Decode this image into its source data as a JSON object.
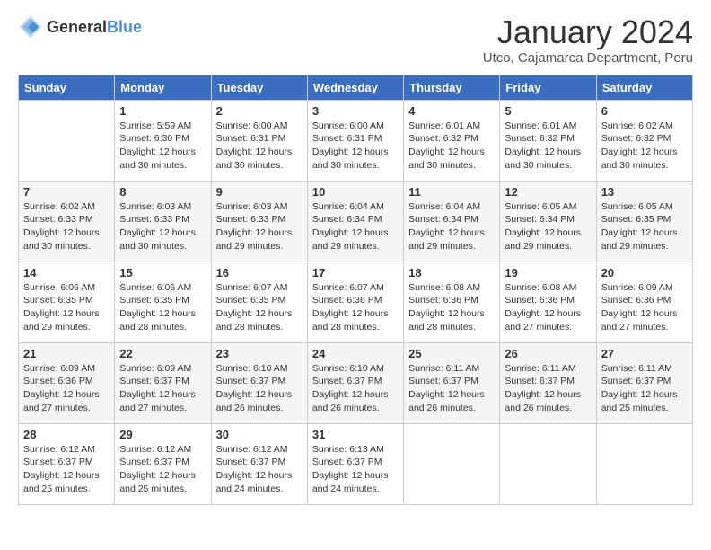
{
  "logo": {
    "text_general": "General",
    "text_blue": "Blue"
  },
  "header": {
    "month_year": "January 2024",
    "location": "Utco, Cajamarca Department, Peru"
  },
  "days_of_week": [
    "Sunday",
    "Monday",
    "Tuesday",
    "Wednesday",
    "Thursday",
    "Friday",
    "Saturday"
  ],
  "weeks": [
    [
      {
        "day": "",
        "sunrise": "",
        "sunset": "",
        "daylight": ""
      },
      {
        "day": "1",
        "sunrise": "Sunrise: 5:59 AM",
        "sunset": "Sunset: 6:30 PM",
        "daylight": "Daylight: 12 hours and 30 minutes."
      },
      {
        "day": "2",
        "sunrise": "Sunrise: 6:00 AM",
        "sunset": "Sunset: 6:31 PM",
        "daylight": "Daylight: 12 hours and 30 minutes."
      },
      {
        "day": "3",
        "sunrise": "Sunrise: 6:00 AM",
        "sunset": "Sunset: 6:31 PM",
        "daylight": "Daylight: 12 hours and 30 minutes."
      },
      {
        "day": "4",
        "sunrise": "Sunrise: 6:01 AM",
        "sunset": "Sunset: 6:32 PM",
        "daylight": "Daylight: 12 hours and 30 minutes."
      },
      {
        "day": "5",
        "sunrise": "Sunrise: 6:01 AM",
        "sunset": "Sunset: 6:32 PM",
        "daylight": "Daylight: 12 hours and 30 minutes."
      },
      {
        "day": "6",
        "sunrise": "Sunrise: 6:02 AM",
        "sunset": "Sunset: 6:32 PM",
        "daylight": "Daylight: 12 hours and 30 minutes."
      }
    ],
    [
      {
        "day": "7",
        "sunrise": "Sunrise: 6:02 AM",
        "sunset": "Sunset: 6:33 PM",
        "daylight": "Daylight: 12 hours and 30 minutes."
      },
      {
        "day": "8",
        "sunrise": "Sunrise: 6:03 AM",
        "sunset": "Sunset: 6:33 PM",
        "daylight": "Daylight: 12 hours and 30 minutes."
      },
      {
        "day": "9",
        "sunrise": "Sunrise: 6:03 AM",
        "sunset": "Sunset: 6:33 PM",
        "daylight": "Daylight: 12 hours and 29 minutes."
      },
      {
        "day": "10",
        "sunrise": "Sunrise: 6:04 AM",
        "sunset": "Sunset: 6:34 PM",
        "daylight": "Daylight: 12 hours and 29 minutes."
      },
      {
        "day": "11",
        "sunrise": "Sunrise: 6:04 AM",
        "sunset": "Sunset: 6:34 PM",
        "daylight": "Daylight: 12 hours and 29 minutes."
      },
      {
        "day": "12",
        "sunrise": "Sunrise: 6:05 AM",
        "sunset": "Sunset: 6:34 PM",
        "daylight": "Daylight: 12 hours and 29 minutes."
      },
      {
        "day": "13",
        "sunrise": "Sunrise: 6:05 AM",
        "sunset": "Sunset: 6:35 PM",
        "daylight": "Daylight: 12 hours and 29 minutes."
      }
    ],
    [
      {
        "day": "14",
        "sunrise": "Sunrise: 6:06 AM",
        "sunset": "Sunset: 6:35 PM",
        "daylight": "Daylight: 12 hours and 29 minutes."
      },
      {
        "day": "15",
        "sunrise": "Sunrise: 6:06 AM",
        "sunset": "Sunset: 6:35 PM",
        "daylight": "Daylight: 12 hours and 28 minutes."
      },
      {
        "day": "16",
        "sunrise": "Sunrise: 6:07 AM",
        "sunset": "Sunset: 6:35 PM",
        "daylight": "Daylight: 12 hours and 28 minutes."
      },
      {
        "day": "17",
        "sunrise": "Sunrise: 6:07 AM",
        "sunset": "Sunset: 6:36 PM",
        "daylight": "Daylight: 12 hours and 28 minutes."
      },
      {
        "day": "18",
        "sunrise": "Sunrise: 6:08 AM",
        "sunset": "Sunset: 6:36 PM",
        "daylight": "Daylight: 12 hours and 28 minutes."
      },
      {
        "day": "19",
        "sunrise": "Sunrise: 6:08 AM",
        "sunset": "Sunset: 6:36 PM",
        "daylight": "Daylight: 12 hours and 27 minutes."
      },
      {
        "day": "20",
        "sunrise": "Sunrise: 6:09 AM",
        "sunset": "Sunset: 6:36 PM",
        "daylight": "Daylight: 12 hours and 27 minutes."
      }
    ],
    [
      {
        "day": "21",
        "sunrise": "Sunrise: 6:09 AM",
        "sunset": "Sunset: 6:36 PM",
        "daylight": "Daylight: 12 hours and 27 minutes."
      },
      {
        "day": "22",
        "sunrise": "Sunrise: 6:09 AM",
        "sunset": "Sunset: 6:37 PM",
        "daylight": "Daylight: 12 hours and 27 minutes."
      },
      {
        "day": "23",
        "sunrise": "Sunrise: 6:10 AM",
        "sunset": "Sunset: 6:37 PM",
        "daylight": "Daylight: 12 hours and 26 minutes."
      },
      {
        "day": "24",
        "sunrise": "Sunrise: 6:10 AM",
        "sunset": "Sunset: 6:37 PM",
        "daylight": "Daylight: 12 hours and 26 minutes."
      },
      {
        "day": "25",
        "sunrise": "Sunrise: 6:11 AM",
        "sunset": "Sunset: 6:37 PM",
        "daylight": "Daylight: 12 hours and 26 minutes."
      },
      {
        "day": "26",
        "sunrise": "Sunrise: 6:11 AM",
        "sunset": "Sunset: 6:37 PM",
        "daylight": "Daylight: 12 hours and 26 minutes."
      },
      {
        "day": "27",
        "sunrise": "Sunrise: 6:11 AM",
        "sunset": "Sunset: 6:37 PM",
        "daylight": "Daylight: 12 hours and 25 minutes."
      }
    ],
    [
      {
        "day": "28",
        "sunrise": "Sunrise: 6:12 AM",
        "sunset": "Sunset: 6:37 PM",
        "daylight": "Daylight: 12 hours and 25 minutes."
      },
      {
        "day": "29",
        "sunrise": "Sunrise: 6:12 AM",
        "sunset": "Sunset: 6:37 PM",
        "daylight": "Daylight: 12 hours and 25 minutes."
      },
      {
        "day": "30",
        "sunrise": "Sunrise: 6:12 AM",
        "sunset": "Sunset: 6:37 PM",
        "daylight": "Daylight: 12 hours and 24 minutes."
      },
      {
        "day": "31",
        "sunrise": "Sunrise: 6:13 AM",
        "sunset": "Sunset: 6:37 PM",
        "daylight": "Daylight: 12 hours and 24 minutes."
      },
      {
        "day": "",
        "sunrise": "",
        "sunset": "",
        "daylight": ""
      },
      {
        "day": "",
        "sunrise": "",
        "sunset": "",
        "daylight": ""
      },
      {
        "day": "",
        "sunrise": "",
        "sunset": "",
        "daylight": ""
      }
    ]
  ]
}
